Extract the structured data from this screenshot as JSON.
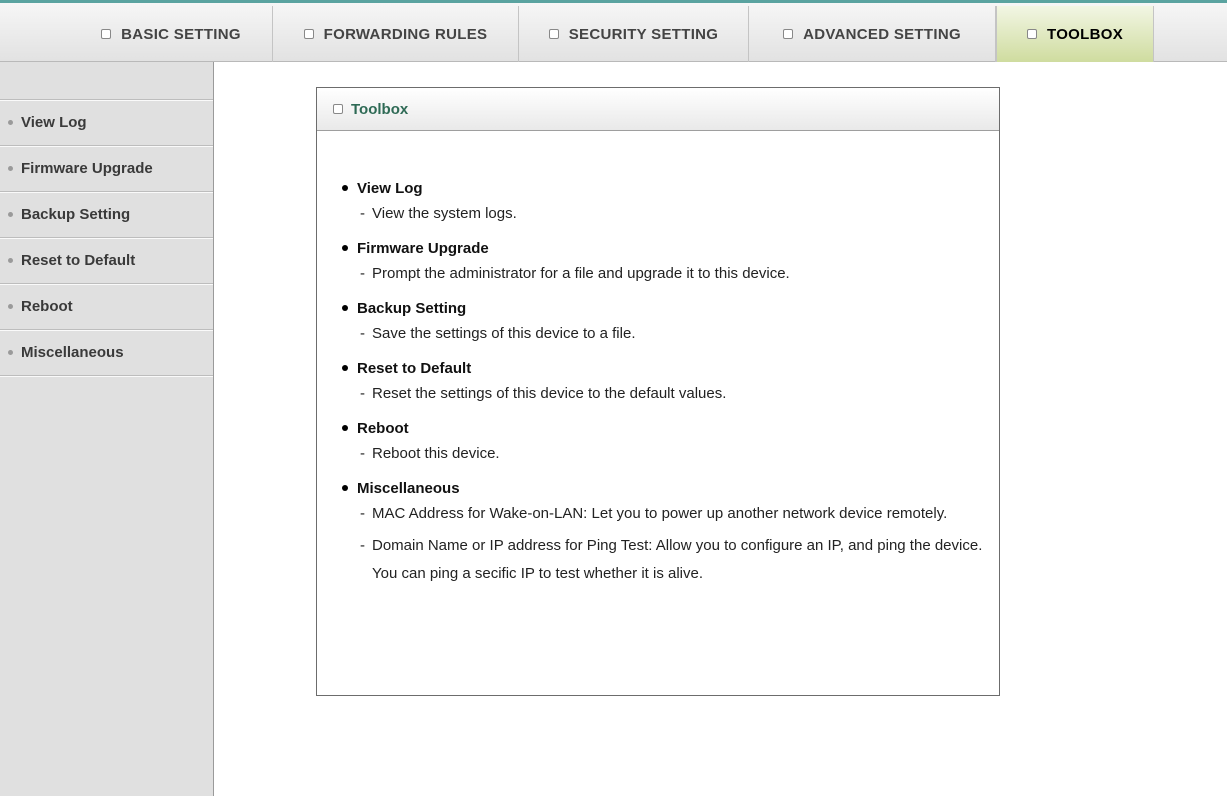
{
  "nav": {
    "tabs": [
      {
        "label": "BASIC SETTING",
        "active": false
      },
      {
        "label": "FORWARDING RULES",
        "active": false
      },
      {
        "label": "SECURITY SETTING",
        "active": false
      },
      {
        "label": "ADVANCED SETTING",
        "active": false
      },
      {
        "label": "TOOLBOX",
        "active": true
      }
    ]
  },
  "sidebar": {
    "items": [
      {
        "label": "View Log"
      },
      {
        "label": "Firmware Upgrade"
      },
      {
        "label": "Backup Setting"
      },
      {
        "label": "Reset to Default"
      },
      {
        "label": "Reboot"
      },
      {
        "label": "Miscellaneous"
      }
    ]
  },
  "panel": {
    "title": "Toolbox",
    "entries": [
      {
        "title": "View Log",
        "descs": [
          "View the system logs."
        ]
      },
      {
        "title": "Firmware Upgrade",
        "descs": [
          "Prompt the administrator for a file and upgrade it to this device."
        ]
      },
      {
        "title": "Backup Setting",
        "descs": [
          "Save the settings of this device to a file."
        ]
      },
      {
        "title": "Reset to Default",
        "descs": [
          "Reset the settings of this device to the default values."
        ]
      },
      {
        "title": "Reboot",
        "descs": [
          "Reboot this device."
        ]
      },
      {
        "title": "Miscellaneous",
        "descs": [
          "MAC Address for Wake-on-LAN: Let you to power up another network device remotely.",
          "Domain Name or IP address for Ping Test: Allow you to configure an IP, and ping the device. You can ping a secific IP to test whether it is alive."
        ]
      }
    ]
  },
  "colors": {
    "accent_top": "#5aa3a0",
    "active_tab": "#cfdc9f",
    "panel_title": "#2e6a55",
    "sidebar_bg": "#e0e0e0"
  },
  "icons": {
    "tab": "square-bullet-icon",
    "sidebar": "dot-icon",
    "entry": "bullet-icon"
  }
}
